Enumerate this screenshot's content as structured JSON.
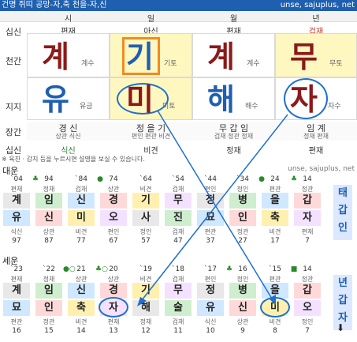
{
  "header": {
    "left": "건명 쥐띠 공망-자,축 천을-자,신",
    "right": "unse, sajuplus, net"
  },
  "pillars": {
    "columns": [
      "시",
      "일",
      "월",
      "년"
    ],
    "sipsin_top": [
      "편재",
      "아신",
      "편재",
      "겁재"
    ],
    "cheongan": [
      {
        "char": "계",
        "sub": "계수",
        "color": "#8b1a1a",
        "bg": "#ffffff"
      },
      {
        "char": "기",
        "sub": "기토",
        "color": "#1f5fb0",
        "bg": "#fff7c0"
      },
      {
        "char": "계",
        "sub": "계수",
        "color": "#8b1a1a",
        "bg": "#ffffff"
      },
      {
        "char": "무",
        "sub": "무토",
        "color": "#8b1a1a",
        "bg": "#fff7c0"
      }
    ],
    "jiji": [
      {
        "char": "유",
        "sub": "유금",
        "color": "#1f5fb0",
        "bg": "#ffffff"
      },
      {
        "char": "미",
        "sub": "미토",
        "color": "#8b1a1a",
        "bg": "#fff7c0"
      },
      {
        "char": "해",
        "sub": "해수",
        "color": "#1f5fb0",
        "bg": "#ffffff"
      },
      {
        "char": "자",
        "sub": "자수",
        "color": "#8b1a1a",
        "bg": "#ffffff"
      }
    ],
    "janggan": [
      {
        "main": "경 신",
        "sub": "상관 식신"
      },
      {
        "main": "정 을 기",
        "sub": "편인 편관 비견"
      },
      {
        "main": "무 갑 임",
        "sub": "겁재 정관 정재"
      },
      {
        "main": "임 계",
        "sub": "정재 편재"
      }
    ],
    "sipsin_bottom": [
      "식신",
      "비견",
      "정재",
      "편재"
    ],
    "row_labels": [
      "십신",
      "천간",
      "지지",
      "장간",
      "십신"
    ]
  },
  "notice": "※ 육친 · 감지 등을 누르시면 설명을 보실 수 있습니다.",
  "daewoon": {
    "title": "대운",
    "site": "unse, sajuplus, net",
    "cols": [
      {
        "age": "`04",
        "ic": "",
        "top": "편재",
        "g": "계",
        "j": "유",
        "bot": "식신",
        "n": "97"
      },
      {
        "age": "94",
        "ic": "♣",
        "top": "정재",
        "g": "임",
        "j": "신",
        "bot": "상관",
        "n": "87"
      },
      {
        "age": "`84",
        "ic": "",
        "top": "겁재",
        "g": "신",
        "j": "미",
        "bot": "비견",
        "n": "77"
      },
      {
        "age": "74",
        "ic": "●",
        "top": "상관",
        "g": "경",
        "j": "오",
        "bot": "편인",
        "n": "67"
      },
      {
        "age": "`64",
        "ic": "",
        "top": "비견",
        "g": "기",
        "j": "사",
        "bot": "정인",
        "n": "57"
      },
      {
        "age": "`54",
        "ic": "",
        "top": "겁재",
        "g": "무",
        "j": "진",
        "bot": "겁재",
        "n": "47"
      },
      {
        "age": "`44",
        "ic": "",
        "top": "편인",
        "g": "정",
        "j": "묘",
        "bot": "편관",
        "n": "37"
      },
      {
        "age": "`34",
        "ic": "",
        "top": "정인",
        "g": "병",
        "j": "인",
        "bot": "정관",
        "n": "27"
      },
      {
        "age": "24",
        "ic": "●",
        "top": "편관",
        "g": "을",
        "j": "축",
        "bot": "비견",
        "n": "17"
      },
      {
        "age": "14",
        "ic": "♣",
        "top": "정관",
        "g": "갑",
        "j": "자",
        "bot": "편재",
        "n": "7"
      }
    ],
    "side": "태 갑 인"
  },
  "sewoon": {
    "title": "세운",
    "cols": [
      {
        "age": "`23",
        "ic": "",
        "top": "편재",
        "g": "계",
        "j": "묘",
        "bot": "편관",
        "n": "16"
      },
      {
        "age": "`22",
        "ic": "",
        "top": "정재",
        "g": "임",
        "j": "인",
        "bot": "정관",
        "n": "15"
      },
      {
        "age": "21",
        "ic": "●○",
        "top": "상관",
        "g": "신",
        "j": "축",
        "bot": "비견",
        "n": "14"
      },
      {
        "age": "20",
        "ic": "♣○",
        "top": "상관",
        "g": "경",
        "j": "자",
        "bot": "편재",
        "n": "13"
      },
      {
        "age": "`19",
        "ic": "",
        "top": "비견",
        "g": "기",
        "j": "해",
        "bot": "정재",
        "n": "12"
      },
      {
        "age": "`18",
        "ic": "",
        "top": "겁재",
        "g": "무",
        "j": "술",
        "bot": "겁재",
        "n": "11"
      },
      {
        "age": "`17",
        "ic": "",
        "top": "편인",
        "g": "정",
        "j": "유",
        "bot": "식신",
        "n": "10"
      },
      {
        "age": "16",
        "ic": "♣",
        "top": "정인",
        "g": "병",
        "j": "신",
        "bot": "상관",
        "n": "9"
      },
      {
        "age": "`15",
        "ic": "",
        "top": "편관",
        "g": "을",
        "j": "미",
        "bot": "비견",
        "n": "8"
      },
      {
        "age": "14",
        "ic": "■",
        "top": "정관",
        "g": "갑",
        "j": "오",
        "bot": "정인",
        "n": "7"
      }
    ],
    "side": "년 갑 자"
  }
}
